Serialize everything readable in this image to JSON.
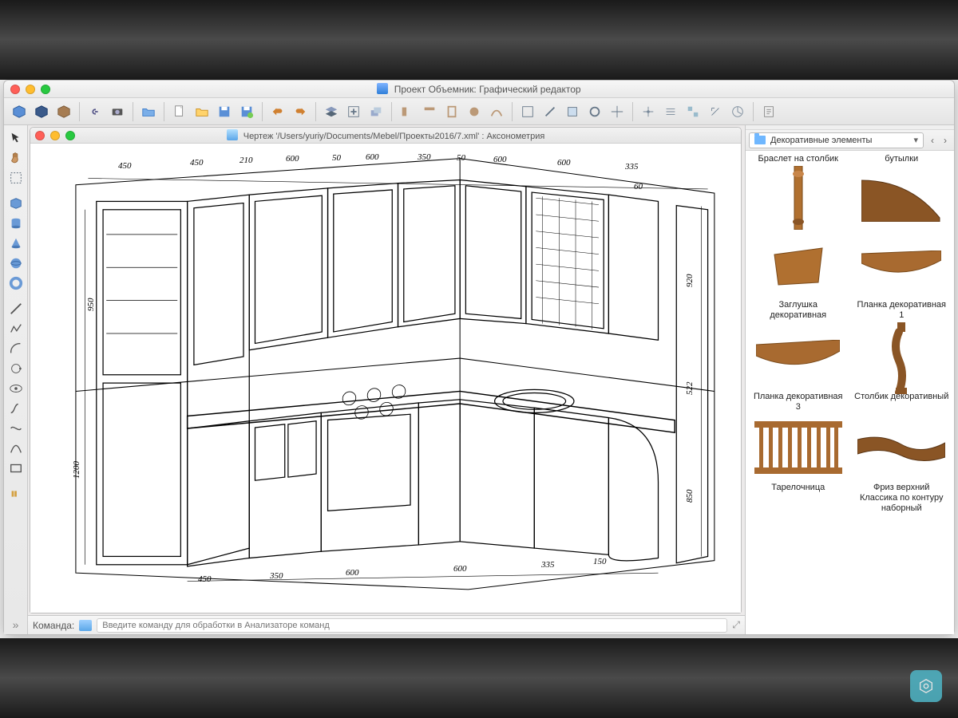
{
  "app": {
    "title": "Проект Объемник: Графический редактор"
  },
  "document": {
    "title": "Чертеж '/Users/yuriy/Documents/Mebel/Проекты2016/7.xml' : Аксонометрия"
  },
  "commandbar": {
    "label": "Команда:",
    "placeholder": "Введите команду для обработки в Анализаторе команд"
  },
  "library": {
    "folder": "Декоративные элементы",
    "items": [
      {
        "label": "Браслет на столбик"
      },
      {
        "label": "бутылки"
      },
      {
        "label": "Заглушка декоративная"
      },
      {
        "label": "Планка декоративная 1"
      },
      {
        "label": "Планка декоративная 3"
      },
      {
        "label": "Столбик декоративный"
      },
      {
        "label": "Тарелочница"
      },
      {
        "label": "Фриз верхний Классика по контуру наборный"
      }
    ]
  },
  "dimensions": {
    "top": [
      "450",
      "450",
      "210",
      "600",
      "50",
      "600",
      "350",
      "50",
      "600",
      "600",
      "335"
    ],
    "bottom": [
      "450",
      "350",
      "600",
      "600",
      "335",
      "150"
    ],
    "leftV": [
      "1200",
      "950"
    ],
    "rightV": [
      "920",
      "522",
      "850"
    ],
    "topRight": "60"
  },
  "toolbar_icons": [
    "cube-blue",
    "cube-dark",
    "cube-brown",
    "sep",
    "link",
    "camera",
    "sep",
    "folder-open",
    "sep",
    "new-doc",
    "open",
    "save",
    "save-as",
    "sep",
    "undo",
    "redo",
    "sep",
    "layers",
    "layer-add",
    "layer-group",
    "sep",
    "object-a",
    "object-b",
    "object-c",
    "object-d",
    "object-e",
    "sep",
    "tool-1",
    "tool-2",
    "tool-3",
    "tool-4",
    "tool-5",
    "sep",
    "opt-1",
    "opt-2",
    "opt-3",
    "opt-4",
    "opt-5",
    "sep",
    "export"
  ],
  "vtool_icons": [
    "cursor",
    "hand",
    "select-rect",
    "sep",
    "cube",
    "cylinder",
    "cone",
    "sphere",
    "torus",
    "sep",
    "line",
    "polyline",
    "arc",
    "orbit",
    "eye",
    "path",
    "spline",
    "curve",
    "rect",
    "sep",
    "more"
  ]
}
